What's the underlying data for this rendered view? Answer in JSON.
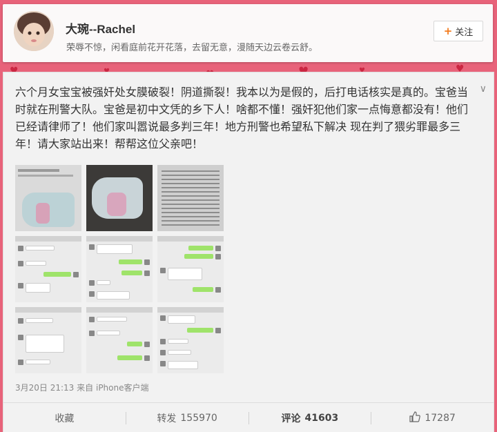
{
  "profile": {
    "name": "大琬--Rachel",
    "bio": "荣辱不惊，闲看庭前花开花落，去留无意，漫随天边云卷云舒。",
    "follow_label": "关注",
    "follow_icon": "plus-icon"
  },
  "post": {
    "text": "六个月女宝宝被强奸处女膜破裂！阴道撕裂！我本以为是假的，后打电话核实是真的。宝爸当时就在刑警大队。宝爸是初中文凭的乡下人！啥都不懂！强奸犯他们家一点悔意都没有！他们已经请律师了！他们家叫嚣说最多判三年！地方刑警也希望私下解决 现在判了猥劣罪最多三年！请大家站出来！帮帮这位父亲吧！",
    "date": "3月20日 21:13",
    "source_prefix": "来自",
    "source": "iPhone客户端",
    "images": [
      {
        "kind": "photo-screenshot"
      },
      {
        "kind": "photo"
      },
      {
        "kind": "document"
      },
      {
        "kind": "chat"
      },
      {
        "kind": "chat"
      },
      {
        "kind": "chat"
      },
      {
        "kind": "chat"
      },
      {
        "kind": "chat"
      },
      {
        "kind": "chat"
      }
    ]
  },
  "actions": {
    "favorite_label": "收藏",
    "repost_label": "转发",
    "repost_count": "155970",
    "comment_label": "评论",
    "comment_count": "41603",
    "like_count": "17287",
    "like_icon": "thumbs-up-icon"
  },
  "colors": {
    "background": "#e8637a",
    "follow_plus": "#f37b1d"
  }
}
